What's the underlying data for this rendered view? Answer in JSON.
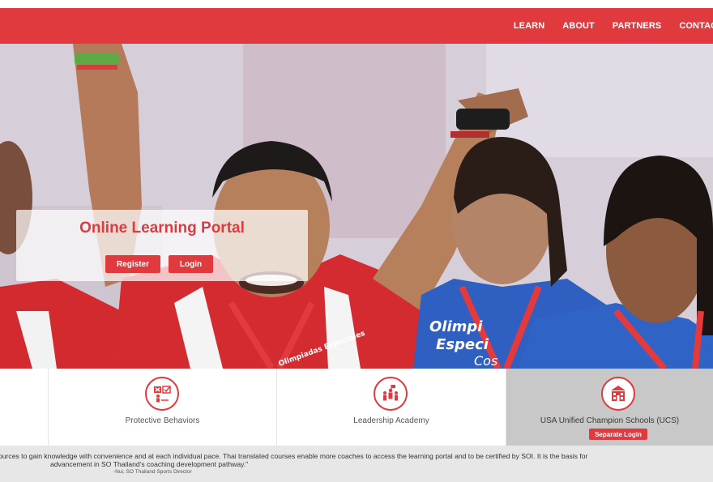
{
  "nav": {
    "links": [
      "LEARN",
      "ABOUT",
      "PARTNERS",
      "CONTACT"
    ]
  },
  "hero": {
    "title": "Online Learning Portal",
    "register_label": "Register",
    "login_label": "Login",
    "shirt_text_center": "Olimpiadas Especiales",
    "shirt_text_right": "Olimpi Especi Cos"
  },
  "tiles": [
    {
      "label": "Protective Behaviors",
      "icon": "checklist-person-icon"
    },
    {
      "label": "Leadership Academy",
      "icon": "leadership-group-icon"
    },
    {
      "label": "USA Unified Champion Schools (UCS)",
      "icon": "school-building-icon",
      "button_label": "Separate Login"
    }
  ],
  "quote": {
    "line1": "ources to gain knowledge with convenience and at each individual pace. Thai translated courses enable more coaches to access the learning portal and to be certified by SOI. It is the basis for",
    "line2": "advancement in SO Thailand's coaching development pathway.\"",
    "attribution": "-Nui, SO Thailand Sports Director"
  },
  "colors": {
    "brand_red": "#e03a3e",
    "quote_bar": "#e7e7e7",
    "ucs_tile": "#c8c8c8"
  }
}
